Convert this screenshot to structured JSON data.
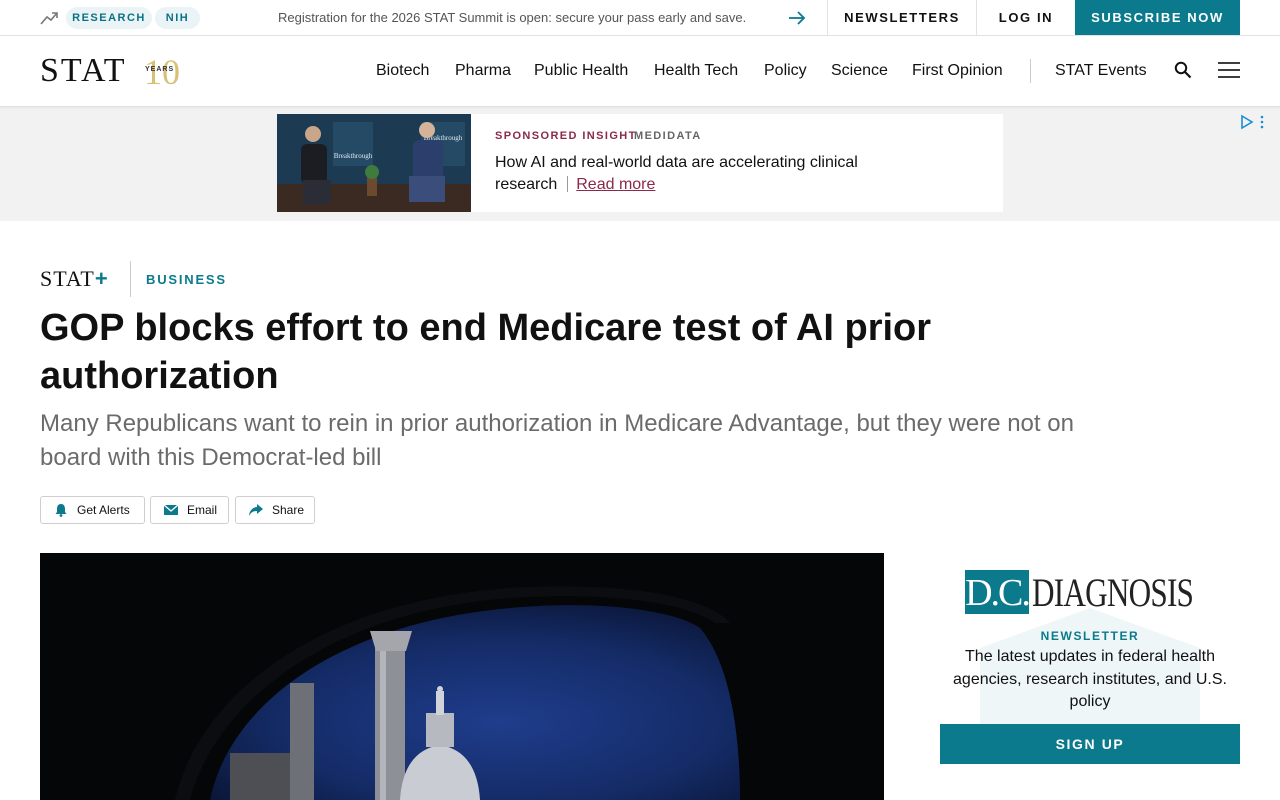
{
  "topbar": {
    "tags": [
      "RESEARCH",
      "NIH"
    ],
    "promo_text": "Registration for the 2026 STAT Summit is open: secure your pass early and save.",
    "newsletters_label": "NEWSLETTERS",
    "login_label": "LOG IN",
    "subscribe_label": "SUBSCRIBE NOW"
  },
  "nav": {
    "logo_text": "STAT",
    "logo_ten": "10",
    "logo_years": "YEARS",
    "items": [
      "Biotech",
      "Pharma",
      "Public Health",
      "Health Tech",
      "Policy",
      "Science",
      "First Opinion"
    ],
    "events_label": "STAT Events"
  },
  "ad": {
    "sponsored_label": "SPONSORED INSIGHT",
    "brand": "MEDIDATA",
    "headline": "How AI and real-world data are accelerating clinical research",
    "read_more": "Read more",
    "stage_text": "Breakthrough"
  },
  "article": {
    "brand": "STAT",
    "brand_plus": "+",
    "section": "BUSINESS",
    "headline": "GOP blocks effort to end Medicare test of AI prior authorization",
    "dek": "Many Republicans want to rein in prior authorization in Medicare Advantage, but they were not on board with this Democrat-led bill",
    "actions": {
      "alerts": "Get Alerts",
      "email": "Email",
      "share": "Share"
    }
  },
  "sidebar": {
    "logo_box": "D.C.",
    "logo_word": "DIAGNOSIS",
    "label": "NEWSLETTER",
    "description": "The latest updates in federal health agencies, research institutes, and U.S. policy",
    "signup_label": "SIGN UP"
  },
  "colors": {
    "accent": "#0b7a8c",
    "sponsored": "#8a2a48",
    "logo_gold": "#d9c074"
  }
}
